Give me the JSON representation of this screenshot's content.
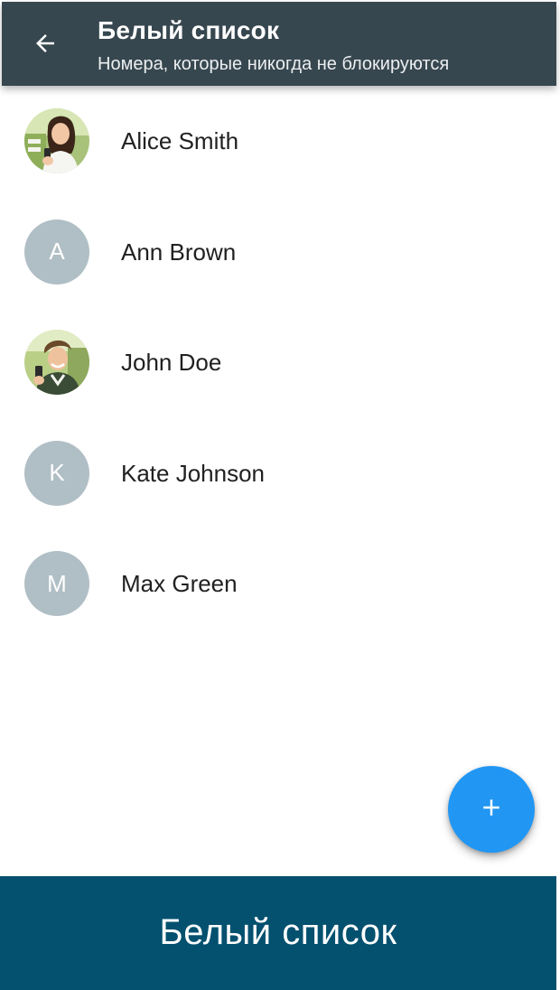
{
  "colors": {
    "appbar_background": "#37474f",
    "avatar_placeholder": "#b0bec5",
    "fab": "#2196f3",
    "banner_background": "#04506f"
  },
  "header": {
    "back_icon": "arrow-left-icon",
    "title": "Белый список",
    "subtitle": "Номера, которые никогда не блокируются"
  },
  "contacts": [
    {
      "name": "Alice Smith",
      "avatar": "photo"
    },
    {
      "name": "Ann Brown",
      "avatar": "initial",
      "initial": "A"
    },
    {
      "name": "John Doe",
      "avatar": "photo"
    },
    {
      "name": "Kate Johnson",
      "avatar": "initial",
      "initial": "K"
    },
    {
      "name": "Max Green",
      "avatar": "initial",
      "initial": "M"
    }
  ],
  "fab": {
    "icon": "plus-icon"
  },
  "banner": {
    "text": "Белый список"
  }
}
